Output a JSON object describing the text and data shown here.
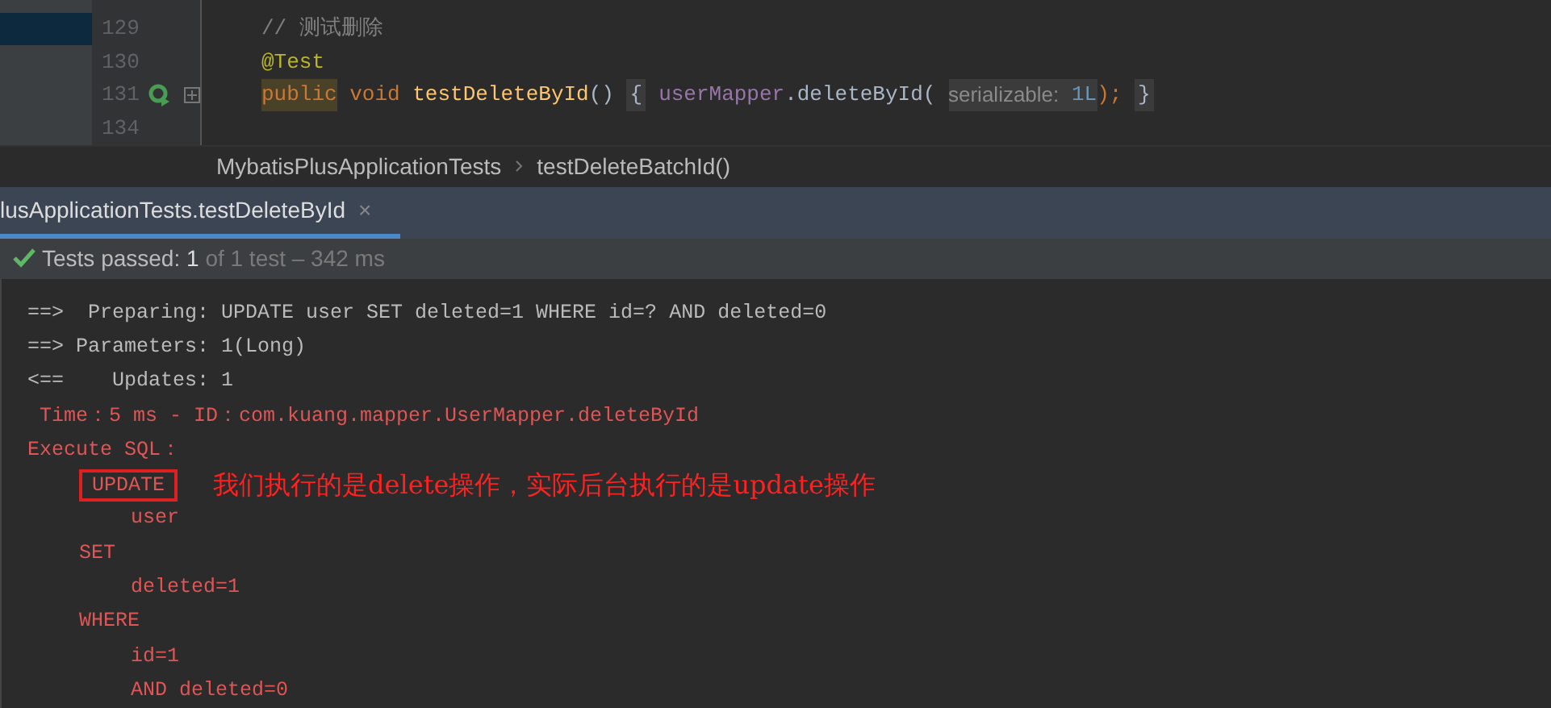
{
  "editor": {
    "lines": [
      {
        "number": "129",
        "selected": true,
        "tokens": [
          {
            "kind": "comment",
            "text": "// 测试删除"
          }
        ]
      },
      {
        "number": "130",
        "selected": false,
        "tokens": [
          {
            "kind": "annotation",
            "text": "@Test"
          }
        ]
      },
      {
        "number": "131",
        "gutter_icon": true,
        "selected": false,
        "tokens": [
          {
            "kind": "keyword_highlight",
            "text": "public"
          },
          {
            "kind": "keyword",
            "text": " void "
          },
          {
            "kind": "method",
            "text": "testDeleteById"
          },
          {
            "kind": "plain",
            "text": "() "
          },
          {
            "kind": "fold",
            "text": "{"
          },
          {
            "kind": "field",
            "text": "userMapper"
          },
          {
            "kind": "plain",
            "text": ".deleteById( "
          },
          {
            "kind": "hint",
            "text": "serializable:"
          },
          {
            "kind": "number",
            "text": " 1L"
          },
          {
            "kind": "keyword",
            "text": "); "
          },
          {
            "kind": "fold",
            "text": "}"
          }
        ]
      },
      {
        "number": "134",
        "selected": false
      }
    ]
  },
  "breadcrumb": [
    "MybatisPlusApplicationTests",
    "testDeleteBatchId()"
  ],
  "run_tab": {
    "label": "lusApplicationTests.testDeleteById",
    "close": "×",
    "selected": true
  },
  "status": {
    "label": "Tests passed:",
    "count": "1",
    "detail": "of 1 test – 342 ms"
  },
  "console": [
    {
      "kind": "plain",
      "text": "==>  Preparing: UPDATE user SET deleted=1 WHERE id=? AND deleted=0"
    },
    {
      "kind": "plain",
      "text": "==> Parameters: 1(Long)"
    },
    {
      "kind": "plain",
      "text": "<==    Updates: 1"
    },
    {
      "kind": "time",
      "text": " Time：5 ms - ID：com.kuang.mapper.UserMapper.deleteById"
    },
    {
      "kind": "sql_head",
      "text": "Execute SQL："
    },
    {
      "kind": "sql_keyword",
      "text": "UPDATE",
      "boxed": true,
      "note": "我们执行的是delete操作，实际后台执行的是update操作"
    },
    {
      "kind": "sql_value",
      "text": "user"
    },
    {
      "kind": "sql_keyword",
      "text": "SET"
    },
    {
      "kind": "sql_value",
      "text": "deleted=1"
    },
    {
      "kind": "sql_keyword",
      "text": "WHERE"
    },
    {
      "kind": "sql_value",
      "text": "id=1"
    },
    {
      "kind": "sql_value",
      "text": "AND deleted=0"
    }
  ]
}
